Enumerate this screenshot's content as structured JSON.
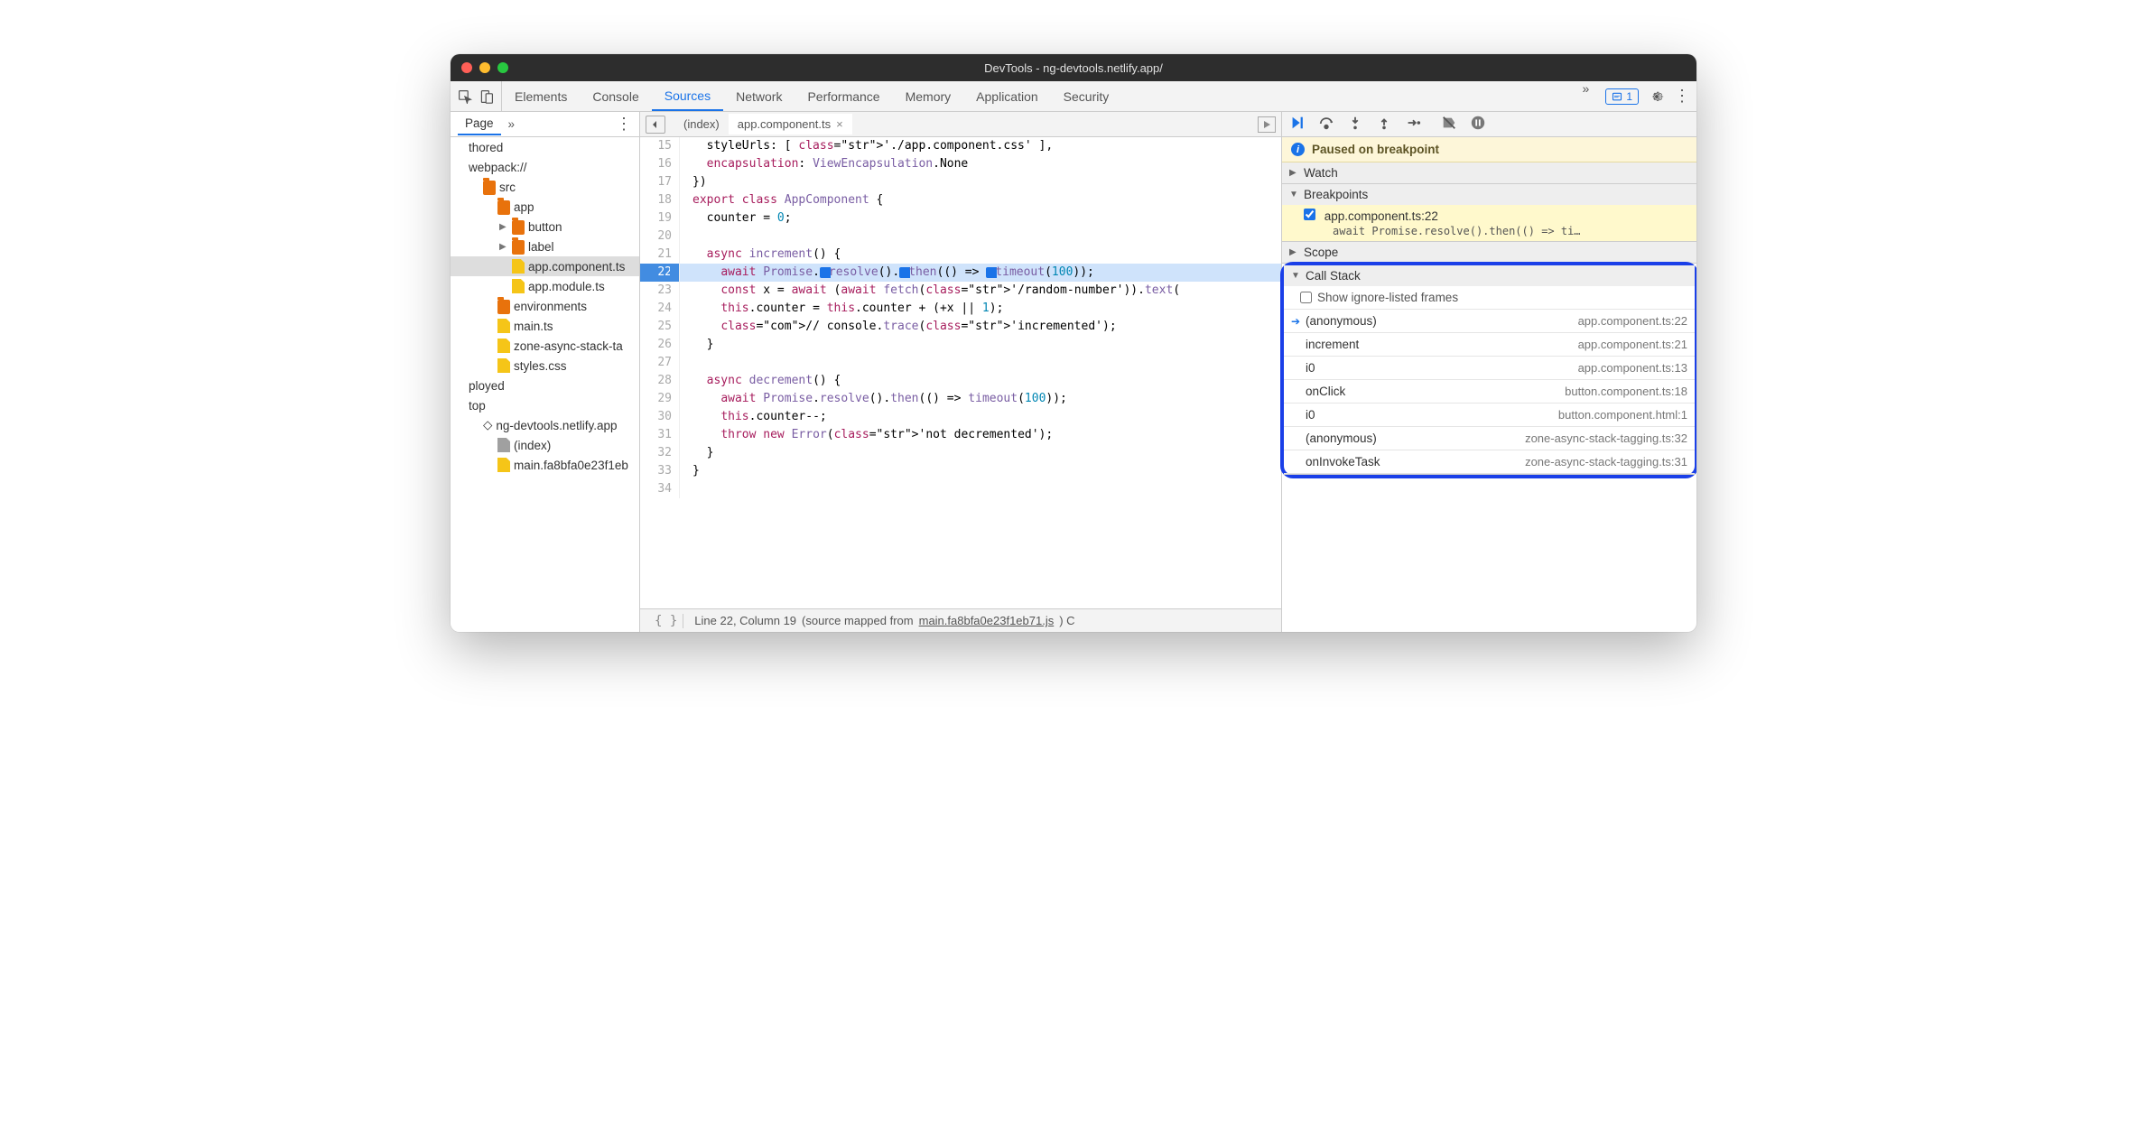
{
  "title": "DevTools - ng-devtools.netlify.app/",
  "mainTabs": [
    "Elements",
    "Console",
    "Sources",
    "Network",
    "Performance",
    "Memory",
    "Application",
    "Security"
  ],
  "activeMainTab": "Sources",
  "issuesCount": "1",
  "navigator": {
    "pageTab": "Page",
    "items": [
      {
        "indent": 0,
        "icon": "",
        "arrow": "",
        "label": "thored"
      },
      {
        "indent": 0,
        "icon": "",
        "arrow": "",
        "label": "webpack://"
      },
      {
        "indent": 1,
        "icon": "fold",
        "arrow": "",
        "label": "src"
      },
      {
        "indent": 2,
        "icon": "fold",
        "arrow": "",
        "label": "app"
      },
      {
        "indent": 3,
        "icon": "fold",
        "arrow": "▶",
        "label": "button"
      },
      {
        "indent": 3,
        "icon": "fold",
        "arrow": "▶",
        "label": "label"
      },
      {
        "indent": 3,
        "icon": "file",
        "arrow": "",
        "label": "app.component.ts",
        "sel": true
      },
      {
        "indent": 3,
        "icon": "file",
        "arrow": "",
        "label": "app.module.ts"
      },
      {
        "indent": 2,
        "icon": "fold",
        "arrow": "",
        "label": "environments"
      },
      {
        "indent": 2,
        "icon": "file",
        "arrow": "",
        "label": "main.ts"
      },
      {
        "indent": 2,
        "icon": "file",
        "arrow": "",
        "label": "zone-async-stack-ta"
      },
      {
        "indent": 2,
        "icon": "file",
        "arrow": "",
        "label": "styles.css"
      },
      {
        "indent": 0,
        "icon": "",
        "arrow": "",
        "label": "ployed"
      },
      {
        "indent": 0,
        "icon": "",
        "arrow": "",
        "label": "top"
      },
      {
        "indent": 1,
        "icon": "cloud",
        "arrow": "",
        "label": "ng-devtools.netlify.app"
      },
      {
        "indent": 2,
        "icon": "filegray",
        "arrow": "",
        "label": "(index)"
      },
      {
        "indent": 2,
        "icon": "file",
        "arrow": "",
        "label": "main.fa8bfa0e23f1eb"
      }
    ]
  },
  "editorTabs": [
    {
      "label": "(index)",
      "active": false,
      "close": false
    },
    {
      "label": "app.component.ts",
      "active": true,
      "close": true
    }
  ],
  "code": {
    "start": 15,
    "lines": [
      {
        "n": 15,
        "html": "  styleUrls: [ './app.component.css' ],",
        "trunc": true
      },
      {
        "n": 16,
        "html": "  encapsulation: ViewEncapsulation.None"
      },
      {
        "n": 17,
        "html": "})"
      },
      {
        "n": 18,
        "html": "export class AppComponent {"
      },
      {
        "n": 19,
        "html": "  counter = 0;"
      },
      {
        "n": 20,
        "html": ""
      },
      {
        "n": 21,
        "html": "  async increment() {"
      },
      {
        "n": 22,
        "html": "    await Promise.resolve().then(() => timeout(100));",
        "exec": true
      },
      {
        "n": 23,
        "html": "    const x = await (await fetch('/random-number')).text("
      },
      {
        "n": 24,
        "html": "    this.counter = this.counter + (+x || 1);"
      },
      {
        "n": 25,
        "html": "    // console.trace('incremented');"
      },
      {
        "n": 26,
        "html": "  }"
      },
      {
        "n": 27,
        "html": ""
      },
      {
        "n": 28,
        "html": "  async decrement() {"
      },
      {
        "n": 29,
        "html": "    await Promise.resolve().then(() => timeout(100));"
      },
      {
        "n": 30,
        "html": "    this.counter--;"
      },
      {
        "n": 31,
        "html": "    throw new Error('not decremented');"
      },
      {
        "n": 32,
        "html": "  }"
      },
      {
        "n": 33,
        "html": "}"
      },
      {
        "n": 34,
        "html": ""
      }
    ]
  },
  "statusbar": {
    "pos": "Line 22, Column 19",
    "mapped": "(source mapped from ",
    "file": "main.fa8bfa0e23f1eb71.js",
    "tail": ") C"
  },
  "debugger": {
    "paused": "Paused on breakpoint",
    "sections": {
      "watch": "Watch",
      "breakpoints": "Breakpoints",
      "scope": "Scope",
      "callstack": "Call Stack"
    },
    "breakpoint": {
      "file": "app.component.ts:22",
      "snippet": "await Promise.resolve().then(() => ti…"
    },
    "showIgnore": "Show ignore-listed frames",
    "stack": [
      {
        "name": "(anonymous)",
        "loc": "app.component.ts:22",
        "current": true
      },
      {
        "name": "increment",
        "loc": "app.component.ts:21"
      },
      {
        "name": "i0",
        "loc": "app.component.ts:13"
      },
      {
        "name": "onClick",
        "loc": "button.component.ts:18"
      },
      {
        "name": "i0",
        "loc": "button.component.html:1"
      },
      {
        "name": "(anonymous)",
        "loc": "zone-async-stack-tagging.ts:32"
      },
      {
        "name": "onInvokeTask",
        "loc": "zone-async-stack-tagging.ts:31"
      }
    ]
  }
}
